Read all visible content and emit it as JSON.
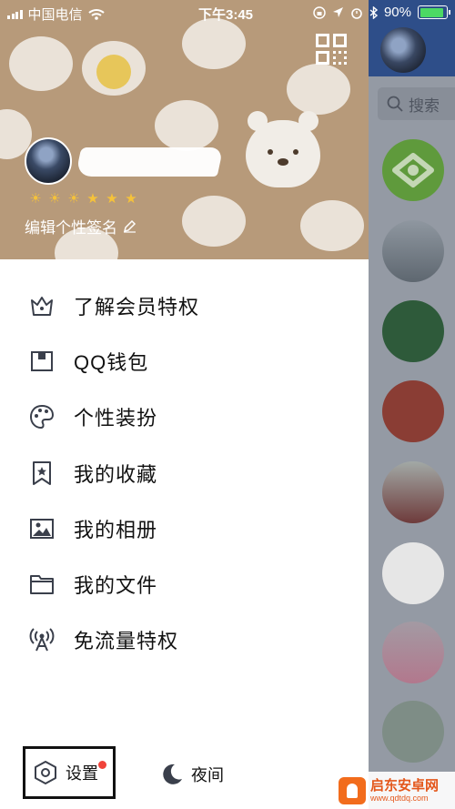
{
  "status_bar": {
    "carrier": "中国电信",
    "time": "下午3:45",
    "battery_percent": "90%",
    "battery_level": 0.9
  },
  "profile": {
    "signature": "编辑个性签名",
    "level_icons": [
      "☀",
      "☀",
      "☀",
      "★",
      "★",
      "★"
    ]
  },
  "menu": [
    {
      "label": "了解会员特权",
      "icon": "crown-icon"
    },
    {
      "label": "QQ钱包",
      "icon": "wallet-icon"
    },
    {
      "label": "个性装扮",
      "icon": "palette-icon"
    },
    {
      "label": "我的收藏",
      "icon": "bookmark-star-icon"
    },
    {
      "label": "我的相册",
      "icon": "photo-icon"
    },
    {
      "label": "我的文件",
      "icon": "folder-icon"
    },
    {
      "label": "免流量特权",
      "icon": "signal-tower-icon"
    }
  ],
  "footer": {
    "settings_label": "设置",
    "night_label": "夜间"
  },
  "peek_panel": {
    "search_placeholder": "搜索"
  },
  "watermark": {
    "title": "启东安卓网",
    "url": "www.qdtdq.com"
  },
  "colors": {
    "header_bg": "#b79a7a",
    "peek_top": "#2e4e89",
    "accent_dot": "#f0433a"
  }
}
